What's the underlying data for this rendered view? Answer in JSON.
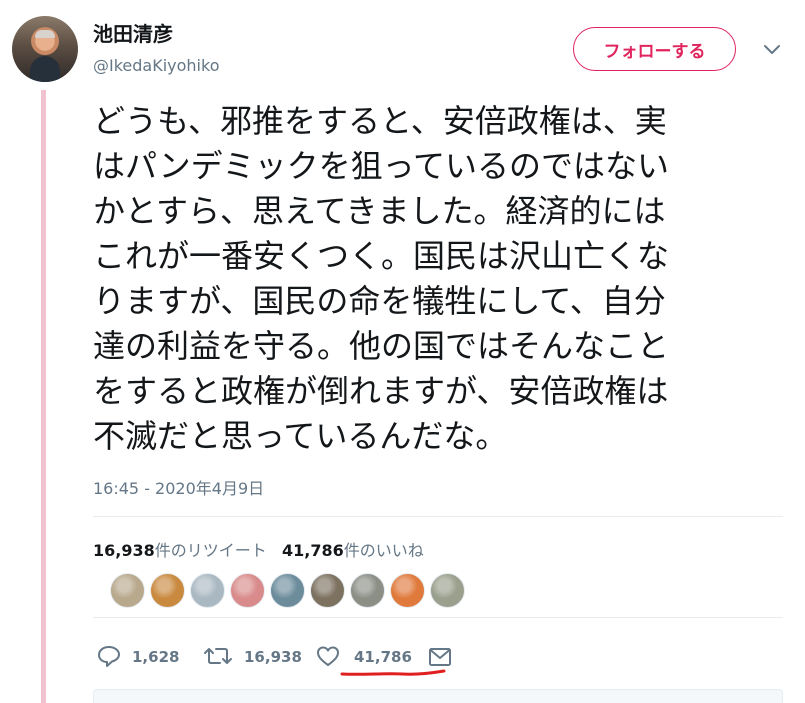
{
  "user": {
    "display_name": "池田清彦",
    "handle": "@IkedaKiyohiko"
  },
  "follow_button": {
    "label": "フォローする"
  },
  "tweet": {
    "lines": [
      "どうも、邪推をすると、安倍政権は、実",
      "はパンデミックを狙っているのではない",
      "かとすら、思えてきました。経済的には",
      "これが一番安くつく。国民は沢山亡くな",
      "りますが、国民の命を犠牲にして、自分",
      "達の利益を守る。他の国ではそんなこと",
      "をすると政権が倒れますが、安倍政権は",
      "不滅だと思っているんだな。"
    ],
    "timestamp": "16:45 - 2020年4月9日"
  },
  "stats": {
    "retweets_count": "16,938",
    "retweets_label": "件のリツイート",
    "likes_count": "41,786",
    "likes_label": "件のいいね"
  },
  "likers": [
    {
      "name": "liker-1",
      "color": "#b8a88c"
    },
    {
      "name": "liker-2",
      "color": "#c9893f"
    },
    {
      "name": "liker-3",
      "color": "#aab8c2"
    },
    {
      "name": "liker-4",
      "color": "#d98b8b"
    },
    {
      "name": "liker-5",
      "color": "#6c8c9c"
    },
    {
      "name": "liker-6",
      "color": "#7d7160"
    },
    {
      "name": "liker-7",
      "color": "#8b8f86"
    },
    {
      "name": "liker-8",
      "color": "#e07a3c"
    },
    {
      "name": "liker-9",
      "color": "#9aa08d"
    }
  ],
  "actions": {
    "reply_count": "1,628",
    "retweet_count": "16,938",
    "like_count": "41,786"
  },
  "colors": {
    "accent": "#e0245e",
    "secondary_text": "#657786",
    "thread_line": "#f1c3d1",
    "annotation_underline": "#e02020"
  },
  "icons": [
    "chevron-down-icon",
    "reply-icon",
    "retweet-icon",
    "heart-icon",
    "mail-icon"
  ]
}
